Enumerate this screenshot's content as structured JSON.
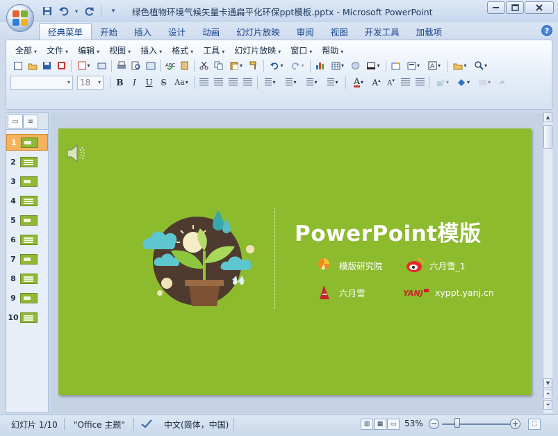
{
  "window": {
    "title": "绿色植物环境气候矢量卡通扁平化环保ppt模板.pptx - Microsoft PowerPoint"
  },
  "qat": {
    "save_icon": "save-icon",
    "undo_icon": "undo-icon",
    "redo_icon": "redo-icon",
    "customize_icon": "qat-customize-icon"
  },
  "ribbon_tabs": [
    "经典菜单",
    "开始",
    "插入",
    "设计",
    "动画",
    "幻灯片放映",
    "审阅",
    "视图",
    "开发工具",
    "加载项"
  ],
  "active_tab": "经典菜单",
  "classic_menu": [
    "全部",
    "文件",
    "编辑",
    "视图",
    "插入",
    "格式",
    "工具",
    "幻灯片放映",
    "窗口",
    "帮助"
  ],
  "font": {
    "name_value": "",
    "size_value": "18"
  },
  "slides": {
    "count": 10,
    "selected": 1,
    "numbers": [
      "1",
      "2",
      "3",
      "4",
      "5",
      "6",
      "7",
      "8",
      "9",
      "10"
    ]
  },
  "slide": {
    "background": "#8dbb2e",
    "title": "PowerPoint模版",
    "info": [
      {
        "icon": "pencil-logo-icon",
        "text": "模版研究院"
      },
      {
        "icon": "weibo-icon",
        "text": "六月雪_1"
      },
      {
        "icon": "author-logo-icon",
        "text": "六月雪"
      },
      {
        "icon": "yanj-logo-icon",
        "text": "xyppt.yanj.cn"
      }
    ]
  },
  "statusbar": {
    "slide_position": "幻灯片 1/10",
    "theme": "\"Office 主题\"",
    "language": "中文(简体，中国)",
    "zoom": "53%",
    "zoom_percent": 53
  },
  "colors": {
    "accent": "#15428b",
    "slide_green": "#8dbb2e",
    "selected_thumb": "#f6b35e"
  }
}
